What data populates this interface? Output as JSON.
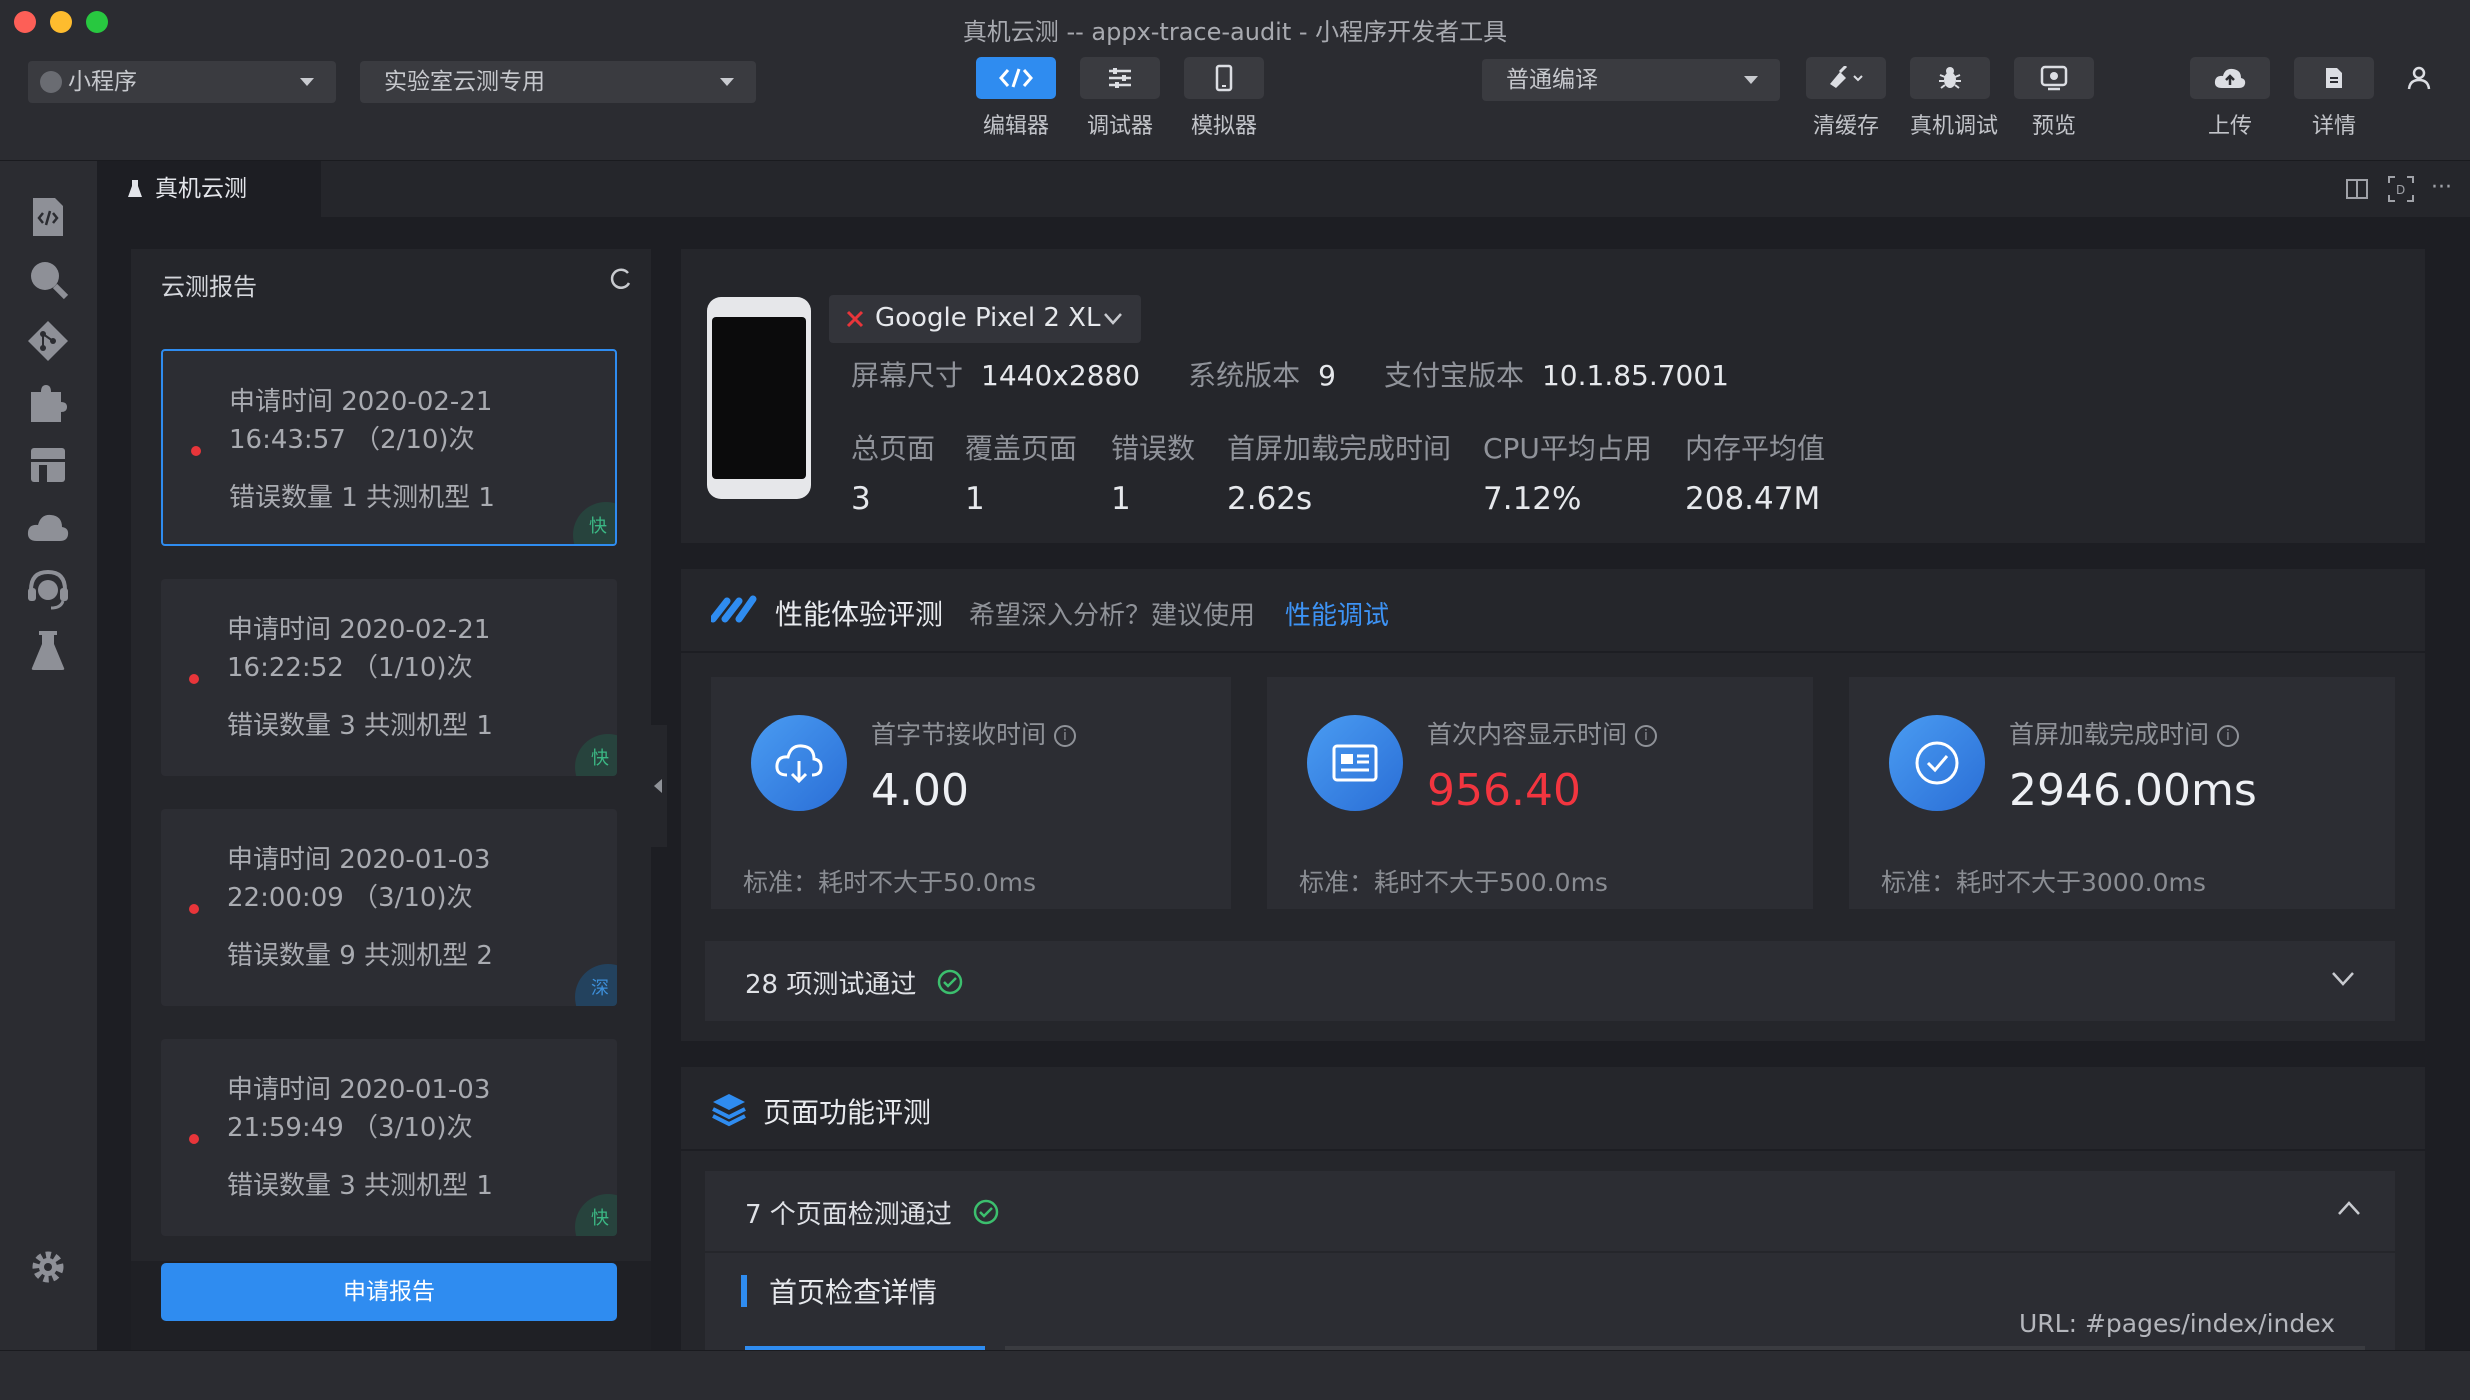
{
  "window": {
    "title": "真机云测 -- appx-trace-audit - 小程序开发者工具"
  },
  "toolbar": {
    "project_type": "小程序",
    "mode": "实验室云测专用",
    "compile_mode": "普通编译",
    "buttons": {
      "editor": "编辑器",
      "debugger": "调试器",
      "simulator": "模拟器",
      "clear_cache": "清缓存",
      "device_debug": "真机调试",
      "preview": "预览",
      "upload": "上传",
      "details": "详情"
    },
    "accent": "#2f8cf0"
  },
  "tab": {
    "label": "真机云测"
  },
  "reports": {
    "title": "云测报告",
    "items": [
      {
        "time_label": "申请时间 2020-02-21",
        "time2": "16:43:57 （2/10)次",
        "stats": "错误数量 1   共测机型 1",
        "tag": "快",
        "selected": true
      },
      {
        "time_label": "申请时间 2020-02-21",
        "time2": "16:22:52 （1/10)次",
        "stats": "错误数量 3   共测机型 1",
        "tag": "快",
        "selected": false
      },
      {
        "time_label": "申请时间 2020-01-03",
        "time2": "22:00:09 （3/10)次",
        "stats": "错误数量 9   共测机型 2",
        "tag": "深",
        "selected": false
      },
      {
        "time_label": "申请时间 2020-01-03",
        "time2": "21:59:49 （3/10)次",
        "stats": "错误数量 3   共测机型 1",
        "tag": "快",
        "selected": false
      }
    ],
    "apply_button": "申请报告"
  },
  "device": {
    "name": "Google Pixel 2 XL",
    "screen_label": "屏幕尺寸",
    "screen_value": "1440x2880",
    "os_label": "系统版本",
    "os_value": "9",
    "alipay_label": "支付宝版本",
    "alipay_value": "10.1.85.7001",
    "stats": [
      {
        "label": "总页面",
        "value": "3"
      },
      {
        "label": "覆盖页面",
        "value": "1"
      },
      {
        "label": "错误数",
        "value": "1"
      },
      {
        "label": "首屏加载完成时间",
        "value": "2.62s"
      },
      {
        "label": "CPU平均占用",
        "value": "7.12%"
      },
      {
        "label": "内存平均值",
        "value": "208.47M"
      }
    ]
  },
  "performance": {
    "title": "性能体验评测",
    "hint": "希望深入分析？建议使用",
    "hint_link": "性能调试",
    "metrics": [
      {
        "title": "首字节接收时间",
        "value": "4.00",
        "standard": "标准：耗时不大于50.0ms",
        "color": "#eef0f4"
      },
      {
        "title": "首次内容显示时间",
        "value": "956.40",
        "standard": "标准：耗时不大于500.0ms",
        "color": "#f2353f"
      },
      {
        "title": "首屏加载完成时间",
        "value": "2946.00ms",
        "standard": "标准：耗时不大于3000.0ms",
        "color": "#eef0f4"
      }
    ],
    "passed": "28  项测试通过"
  },
  "page_eval": {
    "title": "页面功能评测",
    "passed": "7  个页面检测通过",
    "detail_title": "首页检查详情",
    "url": "URL: #pages/index/index"
  }
}
